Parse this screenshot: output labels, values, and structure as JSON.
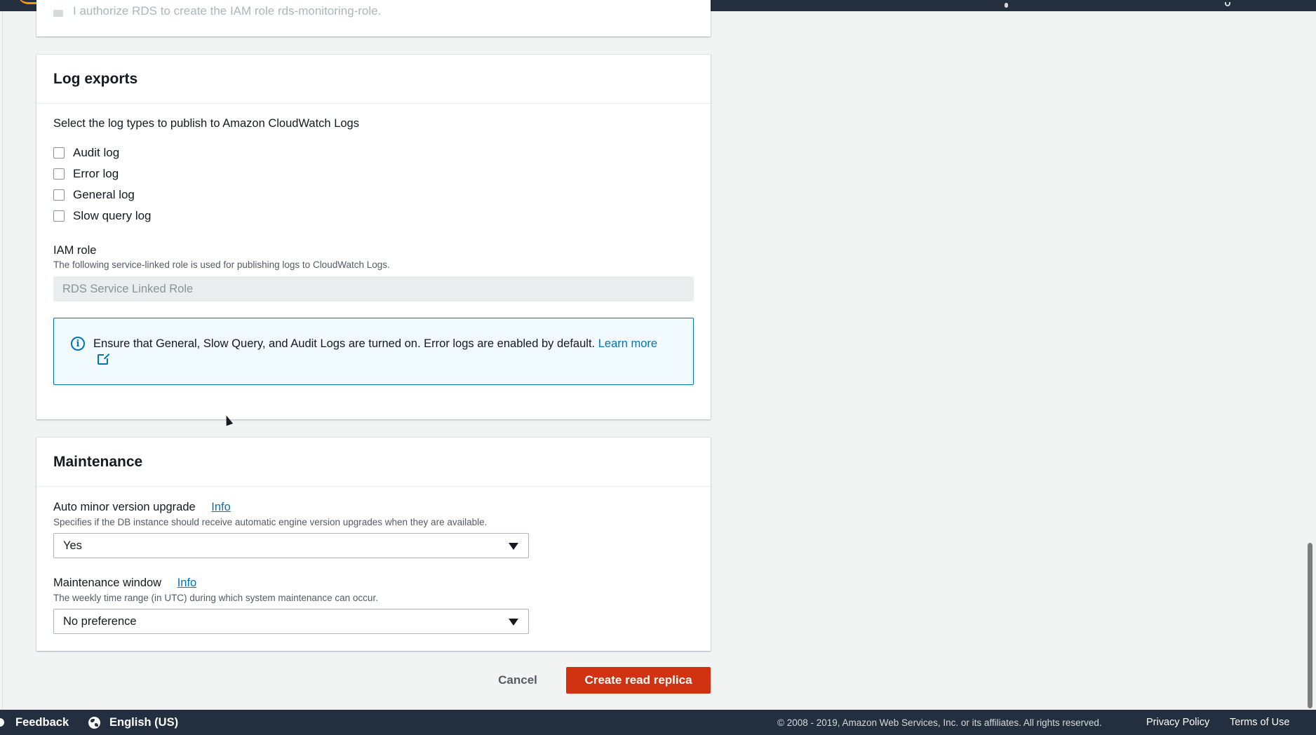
{
  "previous_section": {
    "cut_text": "I authorize RDS to create the IAM role rds-monitoring-role."
  },
  "log_exports": {
    "title": "Log exports",
    "description": "Select the log types to publish to Amazon CloudWatch Logs",
    "checkboxes": [
      {
        "label": "Audit log",
        "checked": false
      },
      {
        "label": "Error log",
        "checked": false
      },
      {
        "label": "General log",
        "checked": false
      },
      {
        "label": "Slow query log",
        "checked": false
      }
    ],
    "iam_role": {
      "label": "IAM role",
      "hint": "The following service-linked role is used for publishing logs to CloudWatch Logs.",
      "value": "RDS Service Linked Role"
    },
    "alert": {
      "text": "Ensure that General, Slow Query, and Audit Logs are turned on. Error logs are enabled by default.",
      "link_text": "Learn more"
    }
  },
  "maintenance": {
    "title": "Maintenance",
    "auto_minor": {
      "label": "Auto minor version upgrade",
      "info": "Info",
      "hint": "Specifies if the DB instance should receive automatic engine version upgrades when they are available.",
      "value": "Yes"
    },
    "window": {
      "label": "Maintenance window",
      "info": "Info",
      "hint": "The weekly time range (in UTC) during which system maintenance can occur.",
      "value": "No preference"
    }
  },
  "actions": {
    "cancel": "Cancel",
    "create": "Create read replica"
  },
  "footer": {
    "feedback": "Feedback",
    "language": "English (US)",
    "copyright": "© 2008 - 2019, Amazon Web Services, Inc. or its affiliates. All rights reserved.",
    "privacy": "Privacy Policy",
    "terms": "Terms of Use"
  },
  "colors": {
    "primary_button": "#d13212",
    "link": "#0073bb",
    "nav_bg": "#232f3e"
  }
}
